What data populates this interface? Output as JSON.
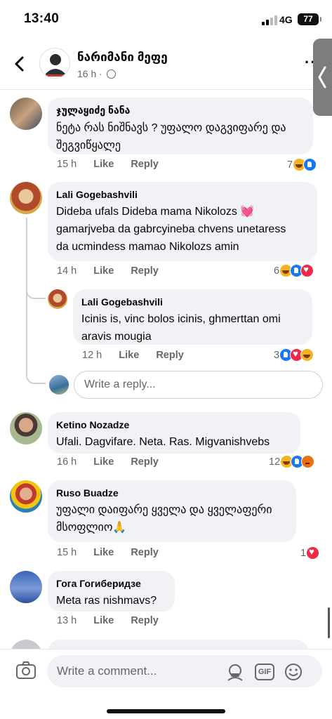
{
  "status_bar": {
    "time": "13:40",
    "network": "4G",
    "battery": "77"
  },
  "header": {
    "page_name": "ნარიმანი მეფე",
    "post_age": "16 h ·",
    "more": "··"
  },
  "actions": {
    "like": "Like",
    "reply": "Reply"
  },
  "comments": [
    {
      "name": "ჯულაყიძე ნანა",
      "lines": [
        "ნეტა რას ნიშნავს ? უფალო დაგვიფარე და",
        "შეგვიწყალე"
      ],
      "age": "15 h",
      "count": "7",
      "reactions": [
        "haha",
        "like"
      ]
    },
    {
      "name": "Lali Gogebashvili",
      "lines": [
        "Dideba ufals Dideba mama Nikolozs 💓",
        "gamarjveba da gabrcyineba chvens unetaress",
        "da ucmindess mamao Nikolozs amin"
      ],
      "age": "14 h",
      "count": "6",
      "reactions": [
        "haha",
        "like",
        "love"
      ]
    },
    {
      "name": "Lali Gogebashvili",
      "lines": [
        "Icinis is, vinc bolos icinis, ghmerttan omi",
        "aravis mougia"
      ],
      "age": "12 h",
      "count": "3",
      "reactions": [
        "like",
        "love",
        "haha"
      ]
    },
    {
      "name": "Ketino Nozadze",
      "lines": [
        "Ufali. Dagvifare.  Neta. Ras. Migvanishvebs"
      ],
      "age": "16 h",
      "count": "12",
      "reactions": [
        "haha",
        "like",
        "angry"
      ]
    },
    {
      "name": "Ruso Buadze",
      "lines": [
        "უფალი დაიფარე ყველა და ყველაფერი",
        "მსოფლიო🙏"
      ],
      "age": "15 h",
      "count": "1",
      "reactions": [
        "love"
      ]
    },
    {
      "name": "Гога Гогиберидзе",
      "lines": [
        "Meta ras nishmavs?"
      ],
      "age": "13 h",
      "count": "",
      "reactions": []
    }
  ],
  "reply_placeholder": "Write a reply...",
  "composer": {
    "placeholder": "Write a comment...",
    "gif": "GIF"
  },
  "colors": {
    "accent": "#1877f2",
    "bubble": "#f0f2f5",
    "meta": "#65676b"
  }
}
